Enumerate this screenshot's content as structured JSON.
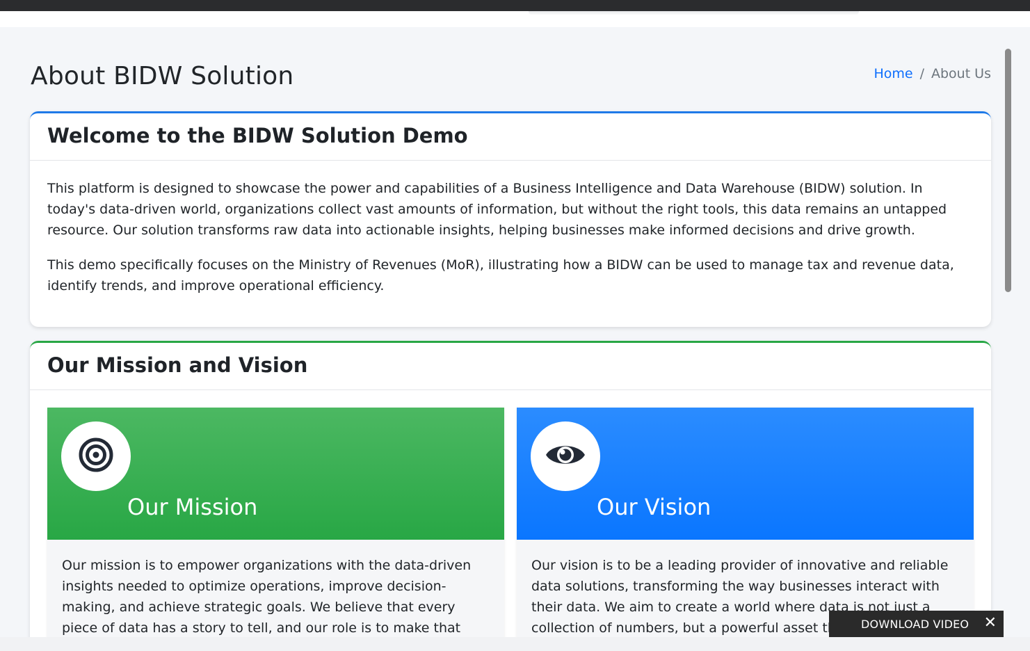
{
  "header": {
    "page_title": "About BIDW Solution",
    "breadcrumb": {
      "home": "Home",
      "separator": "/",
      "current": "About Us"
    }
  },
  "welcome_card": {
    "title": "Welcome to the BIDW Solution Demo",
    "paragraphs": [
      "This platform is designed to showcase the power and capabilities of a Business Intelligence and Data Warehouse (BIDW) solution. In today's data-driven world, organizations collect vast amounts of information, but without the right tools, this data remains an untapped resource. Our solution transforms raw data into actionable insights, helping businesses make informed decisions and drive growth.",
      "This demo specifically focuses on the Ministry of Revenues (MoR), illustrating how a BIDW can be used to manage tax and revenue data, identify trends, and improve operational efficiency."
    ]
  },
  "mission_vision_card": {
    "title": "Our Mission and Vision",
    "mission": {
      "icon": "target-icon",
      "title": "Our Mission",
      "text": "Our mission is to empower organizations with the data-driven insights needed to optimize operations, improve decision-making, and achieve strategic goals. We believe that every piece of data has a story to tell, and our role is to make that story",
      "color": "#28a745"
    },
    "vision": {
      "icon": "eye-icon",
      "title": "Our Vision",
      "text": "Our vision is to be a leading provider of innovative and reliable data solutions, transforming the way businesses interact with their data. We aim to create a world where data is not just a collection of numbers, but a powerful asset th",
      "color": "#0a76ff"
    }
  },
  "download_bar": {
    "label": "DOWNLOAD VIDEO",
    "close": "✕"
  },
  "colors": {
    "accent_blue": "#1f7ae8",
    "accent_green": "#28a745",
    "link": "#0d6efd",
    "background": "#f4f6f9"
  }
}
